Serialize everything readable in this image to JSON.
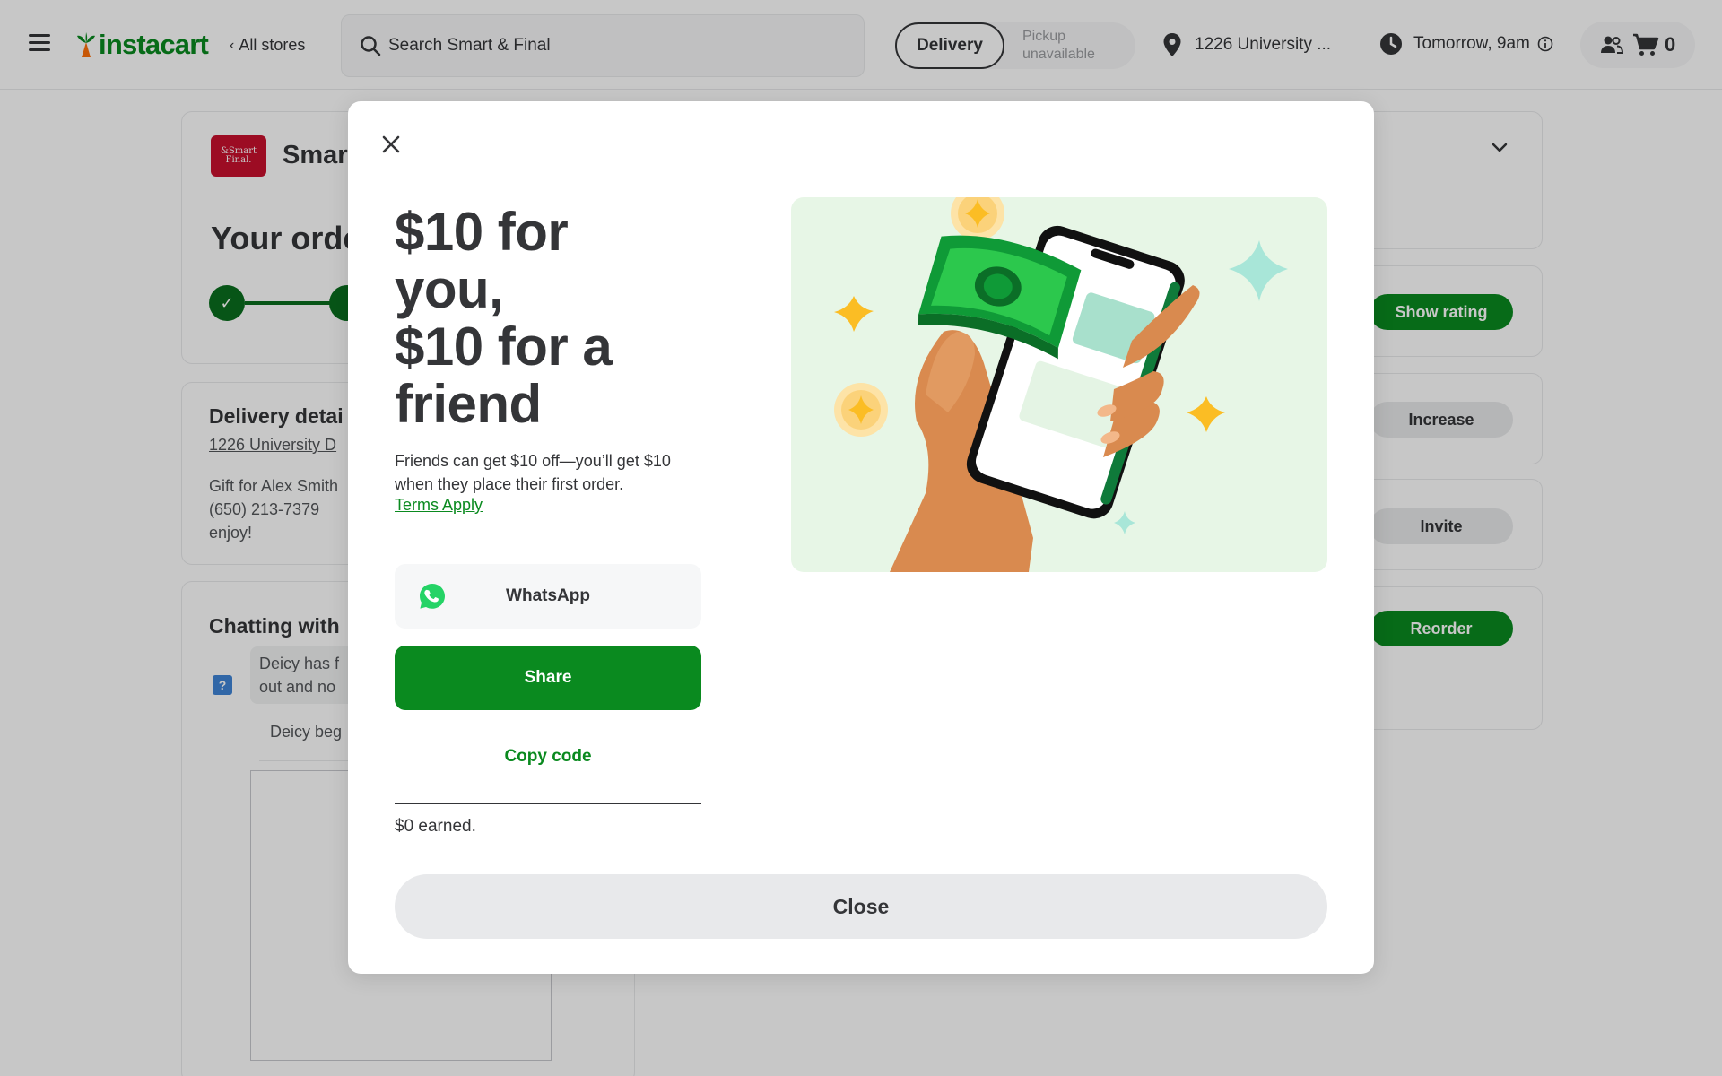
{
  "header": {
    "logo_text": "instacart",
    "all_stores_label": "All stores",
    "search_placeholder": "Search Smart & Final",
    "delivery_label": "Delivery",
    "pickup_label": "Pickup unavailable",
    "address": "1226 University ...",
    "delivery_time": "Tomorrow, 9am",
    "cart_count": "0"
  },
  "background": {
    "store_logo_text": "&Smart Final.",
    "store_name": "Smart",
    "order_title": "Your orde",
    "delivery_title": "Delivery detai",
    "delivery_address": "1226 University D",
    "gift_line1": "Gift for Alex Smith",
    "gift_line2": "(650) 213-7379",
    "gift_line3": "enjoy!",
    "chat_title": "Chatting with",
    "chat_msg1_line1": "Deicy has f",
    "chat_msg1_line2": "out and no",
    "chat_msg2": "Deicy beg",
    "help_icon_text": "?",
    "buttons": {
      "show_rating": "Show rating",
      "increase": "Increase",
      "invite": "Invite",
      "reorder": "Reorder"
    }
  },
  "modal": {
    "headline_lines": [
      "$10 for",
      "you,",
      "$10 for a",
      "friend"
    ],
    "description": "Friends can get $10 off—you’ll get $10 when they place their first order.",
    "terms_label": "Terms Apply",
    "whatsapp_label": "WhatsApp",
    "share_label": "Share",
    "copy_code_label": "Copy code",
    "earned_text": "$0 earned.",
    "close_label": "Close"
  },
  "colors": {
    "brand_green": "#0a8a1f",
    "dark_green": "#0a6e1e",
    "text_dark": "#343538",
    "store_red": "#c8102e",
    "illustration_bg": "#e7f6e6"
  },
  "icons": [
    "menu-icon",
    "carrot-icon",
    "search-icon",
    "location-pin-icon",
    "clock-icon",
    "info-icon",
    "people-icon",
    "cart-icon",
    "close-icon",
    "whatsapp-icon",
    "check-icon",
    "chevron-down-icon",
    "help-icon"
  ]
}
